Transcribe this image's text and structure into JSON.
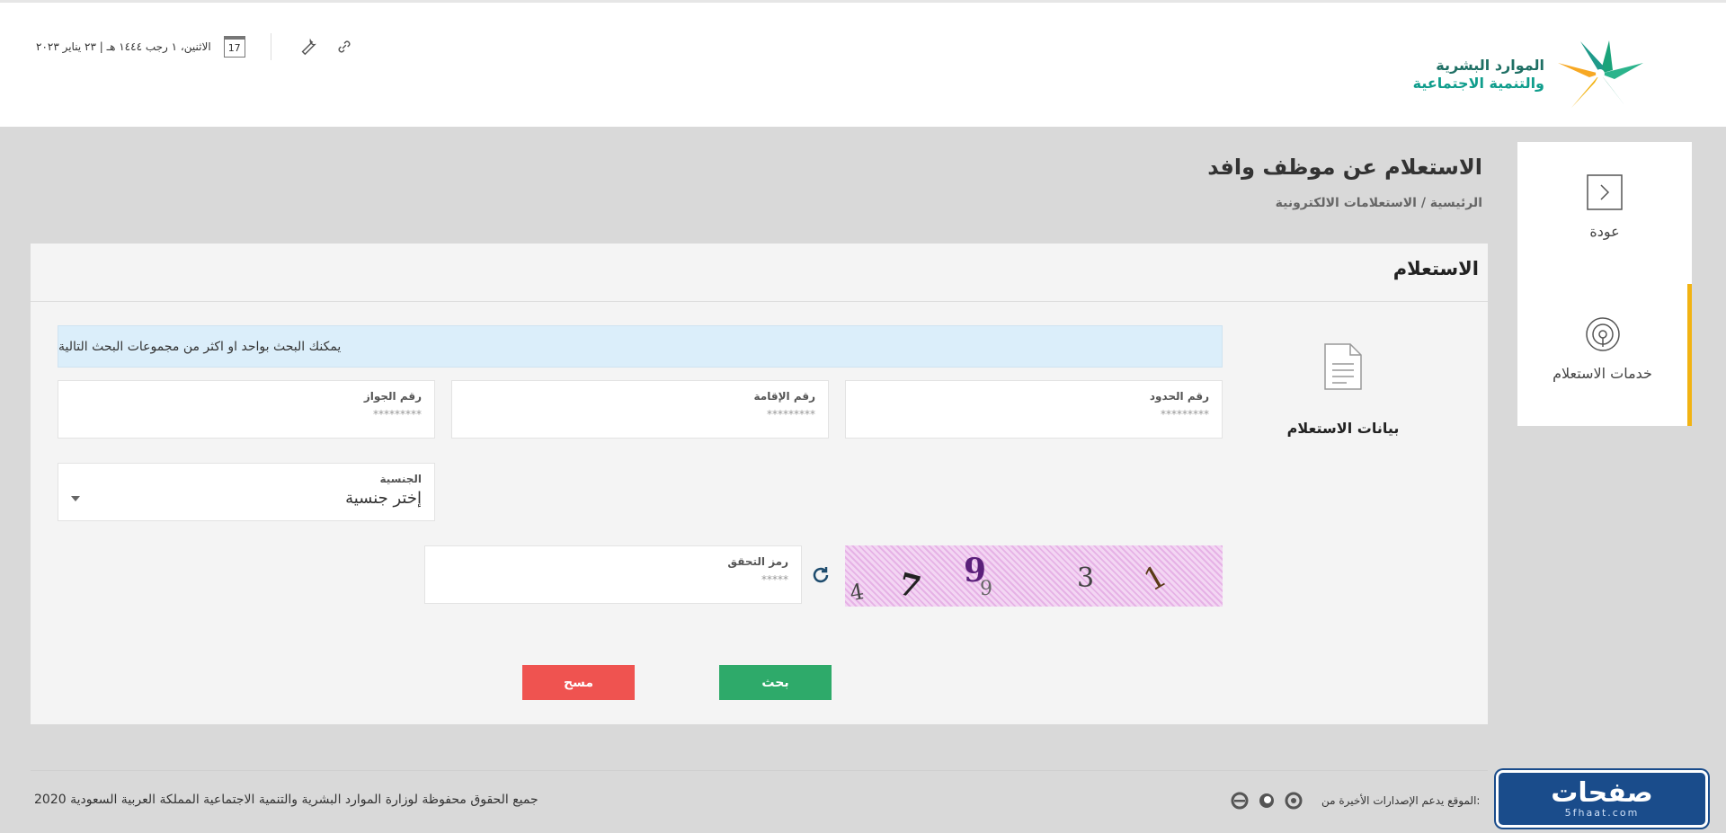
{
  "header": {
    "logo_line1": "الموارد البشرية",
    "logo_line2": "والتنمية الاجتماعية",
    "date_text": "الاثنين، ١ رجب ١٤٤٤ هـ | ٢٣ يناير ٢٠٢٣",
    "calendar_day": "17"
  },
  "side_menu": {
    "back_label": "عودة",
    "services_label": "خدمات الاستعلام"
  },
  "page": {
    "title": "الاستعلام عن موظف وافد",
    "breadcrumb": "الرئيسية / الاستعلامات الالكترونية"
  },
  "panel": {
    "title": "الاستعلام",
    "data_label": "بيانات الاستعلام",
    "info_text": "يمكنك البحث بواحد او اكثر من مجموعات البحث التالية"
  },
  "fields": {
    "hudud": {
      "label": "رقم الحدود",
      "placeholder": "*********"
    },
    "iqama": {
      "label": "رقم الإقامة",
      "placeholder": "*********"
    },
    "passport": {
      "label": "رقم الجواز",
      "placeholder": "*********"
    },
    "nationality": {
      "label": "الجنسية",
      "value": "إختر جنسية"
    },
    "captcha": {
      "label": "رمز التحقق",
      "placeholder": "*****"
    }
  },
  "captcha_text": "4 7 9 9 3 1",
  "buttons": {
    "search": "بحث",
    "clear": "مسح"
  },
  "footer": {
    "copyright": "جميع الحقوق محفوظة لوزارة الموارد البشرية والتنمية الاجتماعية المملكة العربية السعودية 2020",
    "support_text": "الموقع يدعم الإصدارات الأخيرة من:",
    "brand_name": "صفحات",
    "brand_sub": "5fhaat.com"
  },
  "colors": {
    "accent_yellow": "#f2b313",
    "search_green": "#2eaa6a",
    "clear_red": "#ef5350",
    "info_blue": "#dbeefa",
    "logo_teal": "#1e6f64"
  }
}
